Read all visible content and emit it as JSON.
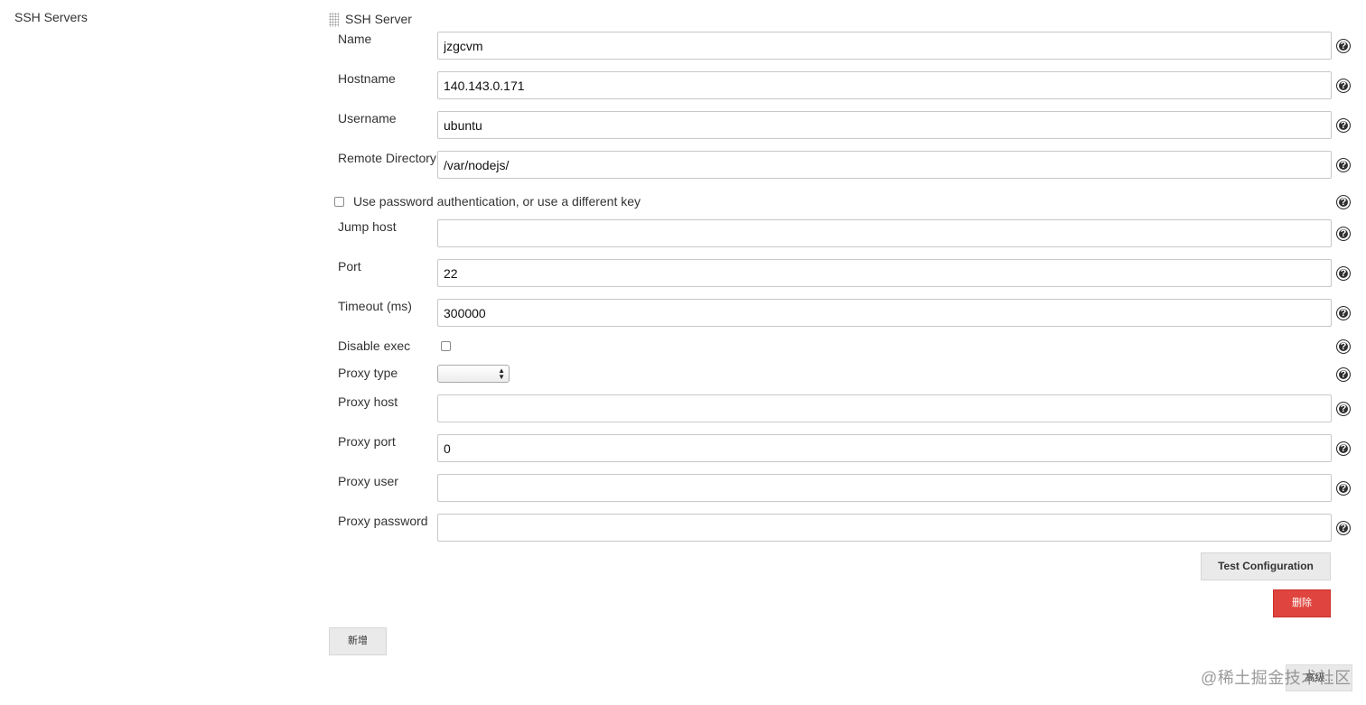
{
  "page": {
    "section_label": "SSH Servers",
    "block_title": "SSH Server"
  },
  "fields": {
    "name": {
      "label": "Name",
      "value": "jzgcvm"
    },
    "hostname": {
      "label": "Hostname",
      "value": "140.143.0.171"
    },
    "username": {
      "label": "Username",
      "value": "ubuntu"
    },
    "remote_directory": {
      "label": "Remote Directory",
      "value": "/var/nodejs/"
    },
    "use_password": {
      "label": "Use password authentication, or use a different key",
      "checked": false
    },
    "jump_host": {
      "label": "Jump host",
      "value": ""
    },
    "port": {
      "label": "Port",
      "value": "22"
    },
    "timeout": {
      "label": "Timeout (ms)",
      "value": "300000"
    },
    "disable_exec": {
      "label": "Disable exec",
      "checked": false
    },
    "proxy_type": {
      "label": "Proxy type",
      "selected": ""
    },
    "proxy_host": {
      "label": "Proxy host",
      "value": ""
    },
    "proxy_port": {
      "label": "Proxy port",
      "value": "0"
    },
    "proxy_user": {
      "label": "Proxy user",
      "value": ""
    },
    "proxy_password": {
      "label": "Proxy password",
      "value": ""
    }
  },
  "buttons": {
    "test_configuration": "Test Configuration",
    "delete": "删除",
    "add": "新增",
    "advanced": "高级..."
  },
  "watermark": "@稀土掘金技术社区",
  "colors": {
    "delete_button": "#e0443e",
    "button_gray": "#eaeaea",
    "help_icon": "#2f2f2f"
  }
}
